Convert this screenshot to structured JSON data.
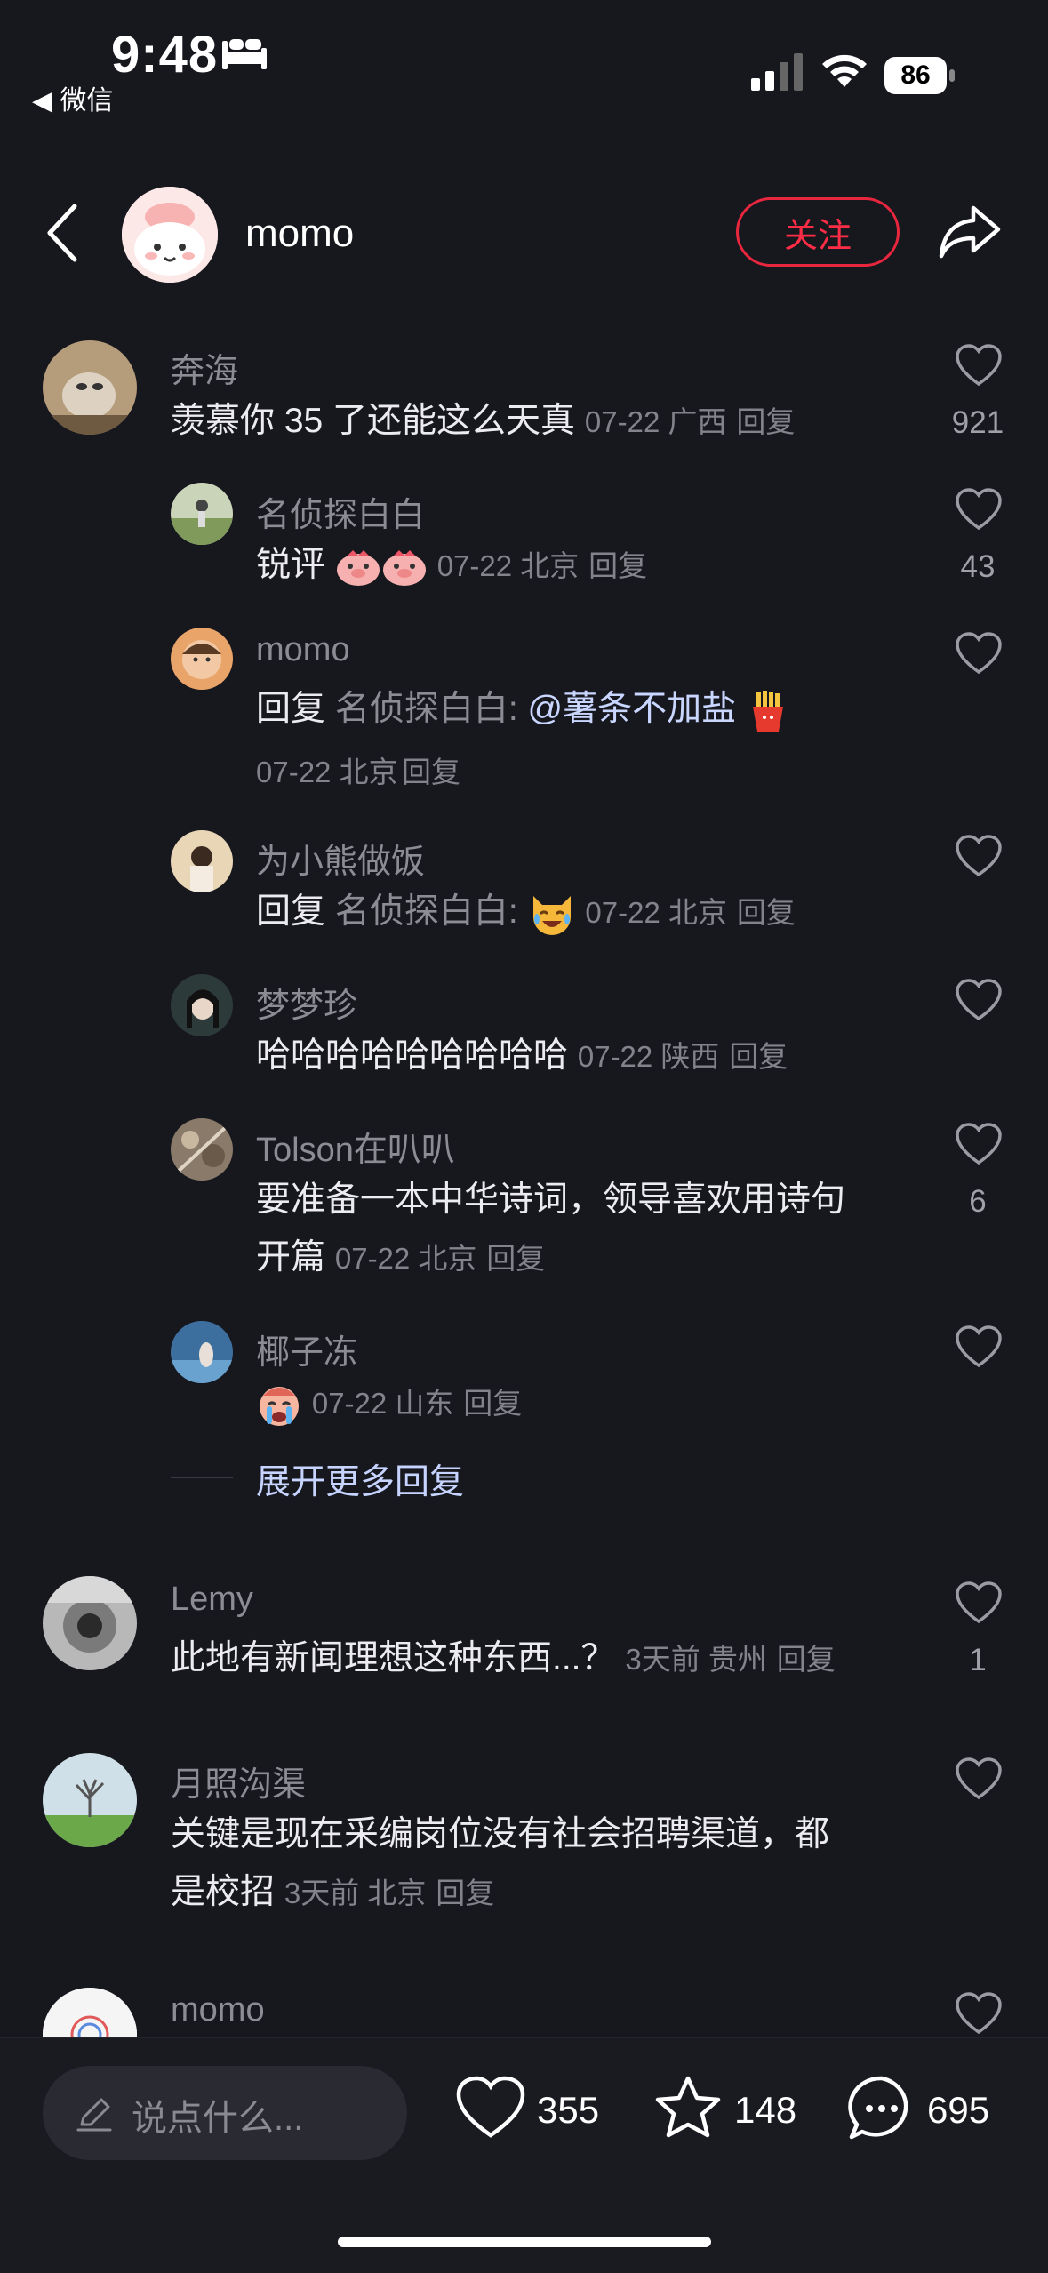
{
  "status_bar": {
    "time": "9:48",
    "back_app": "◀ 微信",
    "battery": "86"
  },
  "header": {
    "username": "momo",
    "follow_label": "关注"
  },
  "comments": [
    {
      "user": "奔海",
      "text": "羡慕你 35 了还能这么天真",
      "meta": "07-22 广西",
      "reply": "回复",
      "likes": "921"
    },
    {
      "user": "名侦探白白",
      "text": "锐评",
      "meta": "07-22 北京",
      "reply": "回复",
      "likes": "43"
    },
    {
      "user": "momo",
      "prefix": "回复",
      "target": "名侦探白白:",
      "mention": "@薯条不加盐",
      "meta": "07-22 北京",
      "reply": "回复",
      "likes": ""
    },
    {
      "user": "为小熊做饭",
      "prefix": "回复",
      "target": "名侦探白白:",
      "meta": "07-22 北京",
      "reply": "回复",
      "likes": ""
    },
    {
      "user": "梦梦珍",
      "text": "哈哈哈哈哈哈哈哈哈",
      "meta": "07-22 陕西",
      "reply": "回复",
      "likes": ""
    },
    {
      "user": "Tolson在叭叭",
      "text": "要准备一本中华诗词，领导喜欢用诗句",
      "text2": "开篇",
      "meta": "07-22 北京",
      "reply": "回复",
      "likes": "6"
    },
    {
      "user": "椰子冻",
      "meta": "07-22 山东",
      "reply": "回复",
      "likes": ""
    },
    {
      "user": "Lemy",
      "text": "此地有新闻理想这种东西...？",
      "meta": "3天前 贵州",
      "reply": "回复",
      "likes": "1"
    },
    {
      "user": "月照沟渠",
      "text": "关键是现在采编岗位没有社会招聘渠道，都",
      "text2": "是校招",
      "meta": "3天前 北京",
      "reply": "回复",
      "likes": ""
    },
    {
      "user": "momo"
    }
  ],
  "expand_label": "展开更多回复",
  "bottom_bar": {
    "placeholder": "说点什么...",
    "likes": "355",
    "favorites": "148",
    "comments": "695"
  }
}
